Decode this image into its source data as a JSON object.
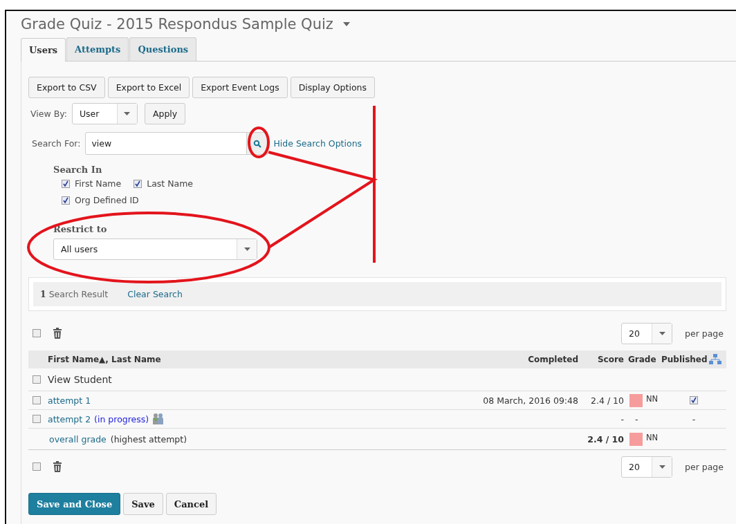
{
  "title": "Grade Quiz - 2015 Respondus Sample Quiz",
  "tabs": [
    {
      "label": "Users",
      "selected": true
    },
    {
      "label": "Attempts",
      "selected": false
    },
    {
      "label": "Questions",
      "selected": false
    }
  ],
  "toolbar_buttons": [
    "Export to CSV",
    "Export to Excel",
    "Export Event Logs",
    "Display Options"
  ],
  "view_by": {
    "label": "View By:",
    "value": "User",
    "apply": "Apply"
  },
  "search": {
    "label": "Search For:",
    "value": "view",
    "toggle_link": "Hide Search Options"
  },
  "search_in": {
    "heading": "Search In",
    "options": [
      {
        "label": "First Name",
        "checked": true
      },
      {
        "label": "Last Name",
        "checked": true
      },
      {
        "label": "Org Defined ID",
        "checked": true
      }
    ]
  },
  "restrict_to": {
    "label": "Restrict to",
    "value": "All users"
  },
  "search_results": {
    "count": "1",
    "label": "Search Result",
    "clear": "Clear Search"
  },
  "top_bar": {
    "select_all_checked": false,
    "per_page": "20",
    "per_page_label": "per page"
  },
  "table": {
    "columns": [
      "First Name▲, Last Name",
      "Completed",
      "Score",
      "Grade",
      "Published"
    ],
    "rows": [
      {
        "kind": "group",
        "checked": false,
        "name": "View Student"
      },
      {
        "kind": "attempt",
        "checked": false,
        "name": "attempt 1",
        "completed": "08 March, 2016 09:48",
        "score": "2.4 / 10",
        "grade": "NN",
        "color": "#f79c9c",
        "published_checked": true
      },
      {
        "kind": "attempt",
        "checked": false,
        "name": "attempt 2",
        "status": "(in progress)",
        "score": "-",
        "grade": "-",
        "published": "-"
      },
      {
        "kind": "summary",
        "name": "overall grade",
        "note": "(highest attempt)",
        "score": "2.4 / 10",
        "grade": "NN",
        "color": "#f79c9c"
      }
    ]
  },
  "bottom_bar": {
    "select_all_checked": false,
    "per_page": "20",
    "per_page_label": "per page"
  },
  "actions": [
    {
      "label": "Save and Close",
      "primary": true
    },
    {
      "label": "Save",
      "primary": false
    },
    {
      "label": "Cancel",
      "primary": false
    }
  ]
}
